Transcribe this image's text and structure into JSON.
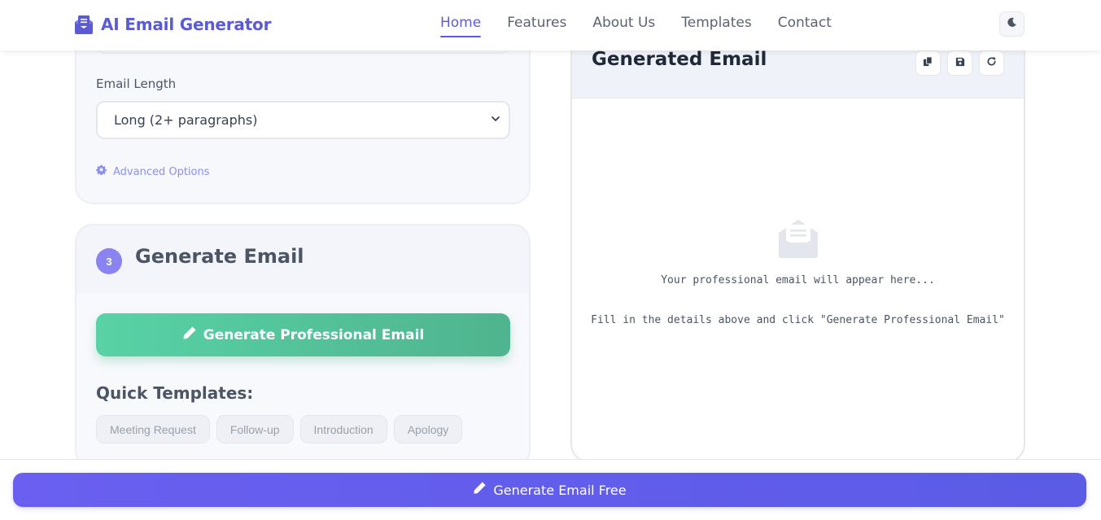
{
  "brand": {
    "title": "AI Email Generator",
    "icon": "envelope-paper-icon",
    "color": "#5b5bd6"
  },
  "nav": {
    "links": [
      "Home",
      "Features",
      "About Us",
      "Templates",
      "Contact"
    ],
    "active": "Home",
    "theme_toggle_icon": "moon-icon"
  },
  "options_card": {
    "length_label": "Email Length",
    "length_value": "Long (2+ paragraphs)",
    "advanced_label": "Advanced Options",
    "advanced_icon": "gear-icon"
  },
  "generate_card": {
    "step_number": "3",
    "title": "Generate Email",
    "button_label": "Generate Professional Email",
    "button_icon": "pencil-icon",
    "quick_templates_title": "Quick Templates:",
    "quick_templates": [
      "Meeting Request",
      "Follow-up",
      "Introduction",
      "Apology"
    ]
  },
  "output": {
    "title": "Generated Email",
    "tools": [
      "copy-icon",
      "save-icon",
      "refresh-icon"
    ],
    "placeholder_icon": "envelope-open-icon",
    "placeholder_line1": "Your professional email will appear here...",
    "placeholder_line2": "Fill in the details above and click \"Generate Professional Email\""
  },
  "bottom_bar": {
    "button_label": "Generate Email Free",
    "button_icon": "pencil-icon"
  },
  "colors": {
    "accent": "#5b5bd6",
    "generate_green": "#52c59b",
    "bottom_button": "#5f5dec"
  }
}
